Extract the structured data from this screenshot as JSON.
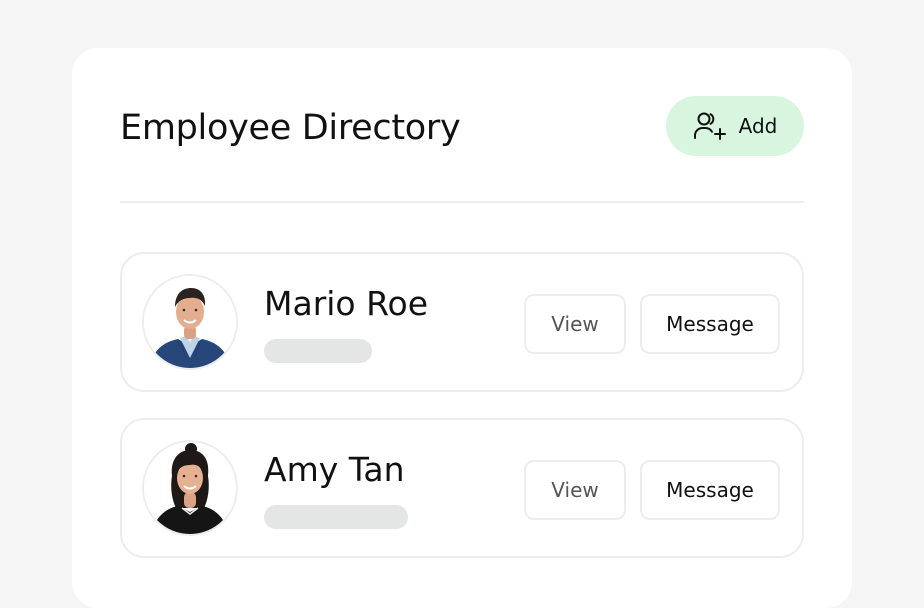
{
  "directory": {
    "title": "Employee Directory",
    "add_label": "Add"
  },
  "icons": {
    "add": "add-user-icon"
  },
  "colors": {
    "add_button_bg": "#d8f6df",
    "page_bg": "#f4f5f4",
    "placeholder": "#e3e6e4"
  },
  "employees": [
    {
      "name": "Mario Roe",
      "view_label": "View",
      "message_label": "Message"
    },
    {
      "name": "Amy Tan",
      "view_label": "View",
      "message_label": "Message"
    }
  ]
}
